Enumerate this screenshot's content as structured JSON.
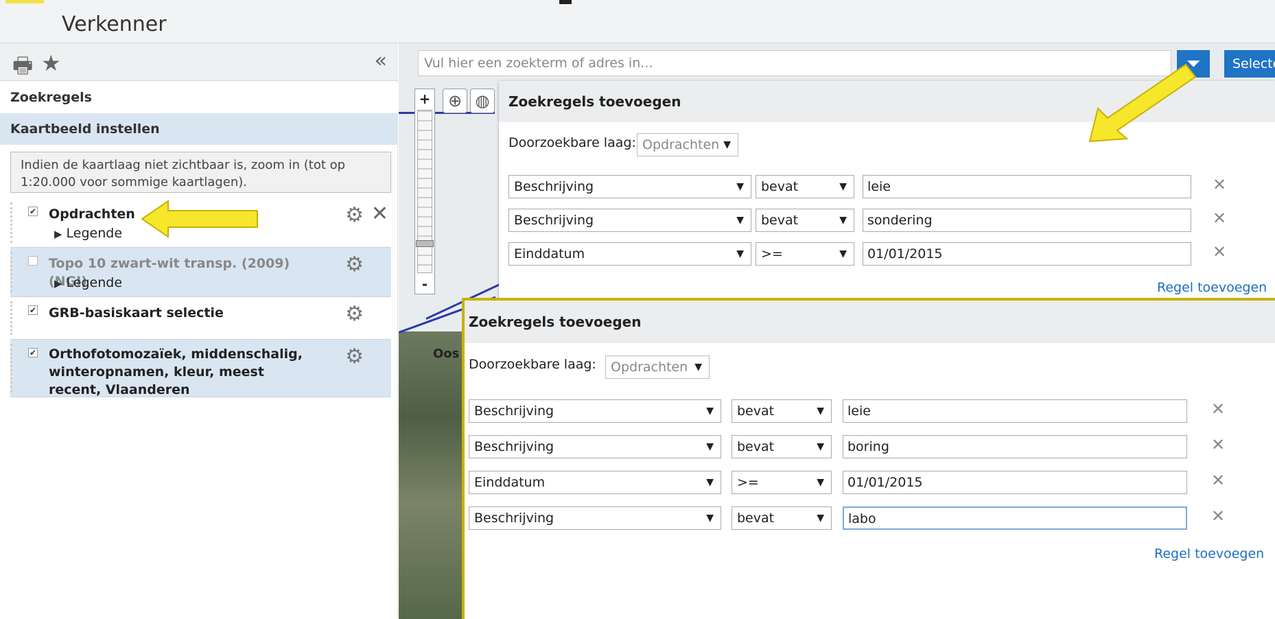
{
  "app": {
    "title": "Verkenner"
  },
  "sidebar": {
    "sections": {
      "search_rules": "Zoekregels",
      "set_map_view": "Kaartbeeld instellen"
    },
    "info": "Indien de kaartlaag niet zichtbaar is, zoom in (tot op 1:20.000 voor sommige kaartlagen).",
    "layers": [
      {
        "name": "Opdrachten",
        "checked": true,
        "legend": "Legende",
        "removable": true
      },
      {
        "name": "Topo 10 zwart-wit transp. (2009) (NGI)",
        "checked": false,
        "legend": "Legende",
        "removable": false
      },
      {
        "name": "GRB-basiskaart selectie",
        "checked": true,
        "removable": false
      },
      {
        "name": "Orthofotomozaïek, middenschalig, winteropnamen, kleur, meest recent, Vlaanderen",
        "checked": true,
        "removable": false
      }
    ]
  },
  "map": {
    "search": {
      "placeholder": "Vul hier een zoekterm of adres in..."
    },
    "select_label": "Selecte",
    "place_label": "Oos"
  },
  "dialog1": {
    "title": "Zoekregels toevoegen",
    "layer_label": "Doorzoekbare laag:",
    "layer_value": "Opdrachten",
    "rules": [
      {
        "field": "Beschrijving",
        "op": "bevat",
        "value": "leie"
      },
      {
        "field": "Beschrijving",
        "op": "bevat",
        "value": "sondering"
      },
      {
        "field": "Einddatum",
        "op": ">=",
        "value": "01/01/2015"
      }
    ],
    "add_rule": "Regel toevoegen"
  },
  "dialog2": {
    "title": "Zoekregels toevoegen",
    "layer_label": "Doorzoekbare laag:",
    "layer_value": "Opdrachten",
    "rules": [
      {
        "field": "Beschrijving",
        "op": "bevat",
        "value": "leie"
      },
      {
        "field": "Beschrijving",
        "op": "bevat",
        "value": "boring"
      },
      {
        "field": "Einddatum",
        "op": ">=",
        "value": "01/01/2015"
      },
      {
        "field": "Beschrijving",
        "op": "bevat",
        "value": "labo"
      }
    ],
    "add_rule": "Regel toevoegen"
  },
  "colors": {
    "accent": "#1f74c6",
    "highlight": "#f3e14a",
    "panel_active": "#d9e6f2"
  },
  "icons": [
    "print-icon",
    "star-icon",
    "collapse-icon",
    "gear-icon",
    "close-icon",
    "filter-icon",
    "zoom-in-icon",
    "globe-icon",
    "remove-rule-icon"
  ]
}
